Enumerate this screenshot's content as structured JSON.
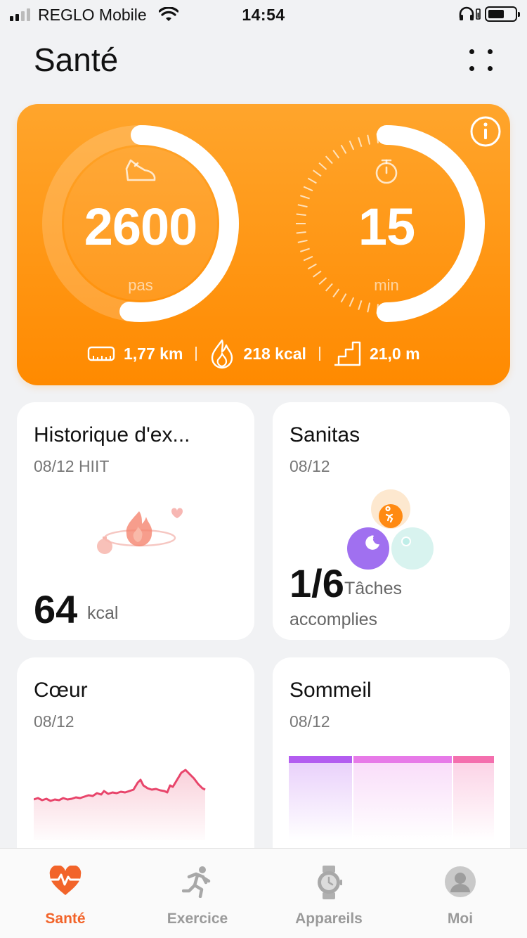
{
  "status_bar": {
    "carrier": "REGLO Mobile",
    "time": "14:54"
  },
  "header": {
    "title": "Santé"
  },
  "activity": {
    "steps": {
      "value": "2600",
      "unit": "pas",
      "progress": 0.52
    },
    "duration": {
      "value": "15",
      "unit": "min",
      "progress": 0.5
    },
    "distance": "1,77 km",
    "calories": "218 kcal",
    "climb": "21,0 m"
  },
  "tiles": {
    "exercise_history": {
      "title": "Historique d'ex...",
      "date": "08/12 HIIT",
      "value": "64",
      "unit": "kcal"
    },
    "sanitas": {
      "title": "Sanitas",
      "date": "08/12",
      "value": "1/6",
      "unit_line1": "Tâches",
      "unit_line2": "accomplies"
    },
    "heart": {
      "title": "Cœur",
      "date": "08/12"
    },
    "sleep": {
      "title": "Sommeil",
      "date": "08/12"
    }
  },
  "nav": {
    "items": [
      {
        "label": "Santé",
        "icon": "heart-pulse-icon",
        "active": true
      },
      {
        "label": "Exercice",
        "icon": "running-icon",
        "active": false
      },
      {
        "label": "Appareils",
        "icon": "watch-icon",
        "active": false
      },
      {
        "label": "Moi",
        "icon": "user-icon",
        "active": false
      }
    ]
  },
  "colors": {
    "accent": "#f2642a",
    "card_orange": "#ff9a16",
    "heart_line": "#e8456b",
    "sleep_purple": "#b35cf0",
    "sleep_pink": "#f46fae"
  }
}
